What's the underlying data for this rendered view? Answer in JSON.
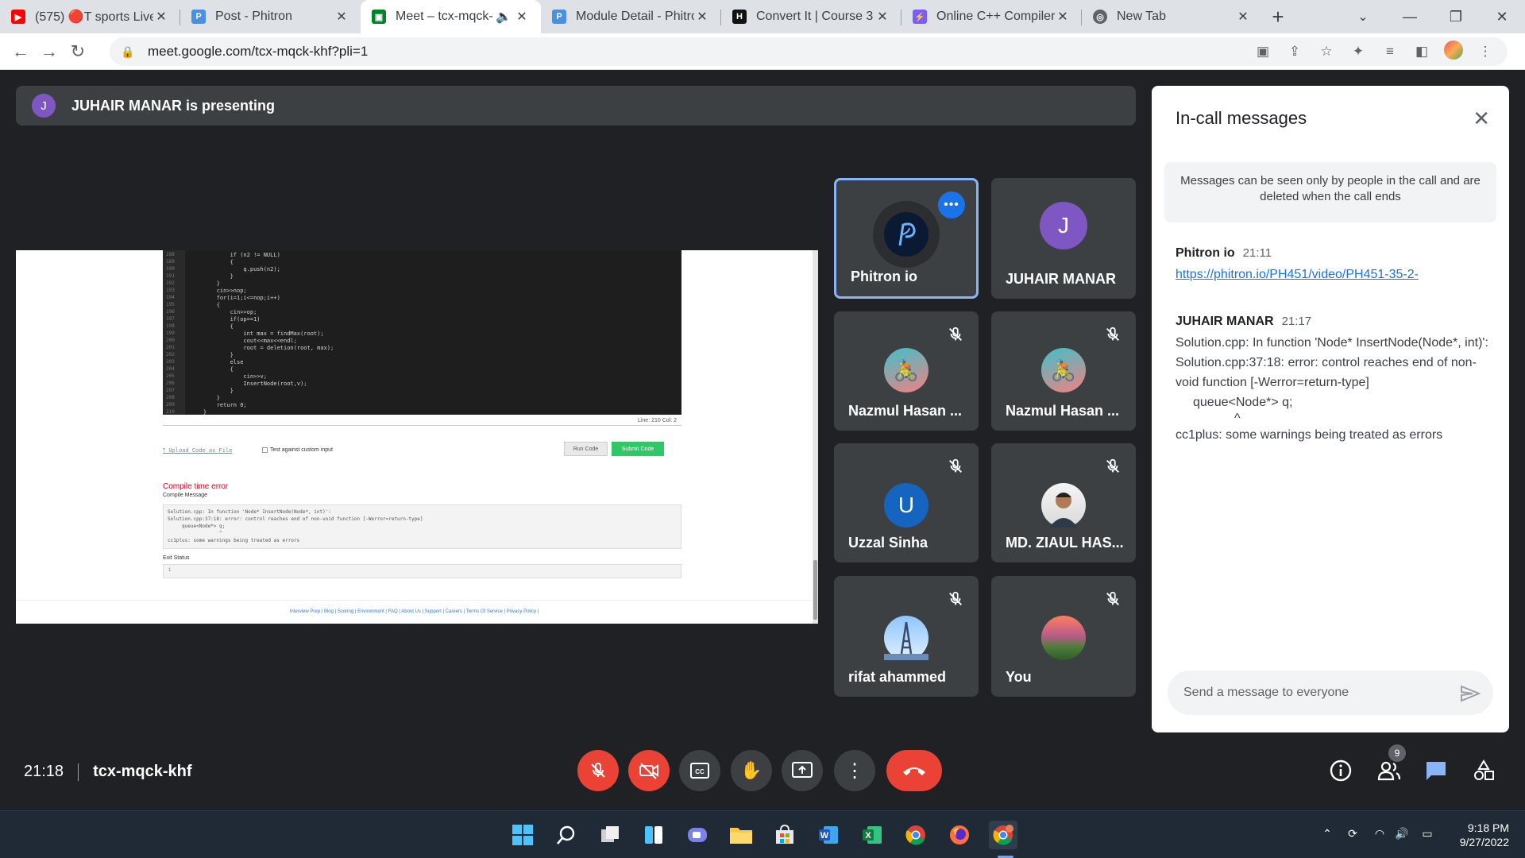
{
  "browser": {
    "tabs": [
      {
        "title": "(575) 🔴T sports Live",
        "favicon_color": "#ff0000",
        "favicon_glyph": "▶"
      },
      {
        "title": "Post - Phitron",
        "favicon_color": "#4a90e2",
        "favicon_glyph": "P"
      },
      {
        "title": "Meet – tcx-mqck-",
        "favicon_color": "#00832d",
        "favicon_glyph": "▣",
        "audio_icon": "speaker-icon"
      },
      {
        "title": "Module Detail - Phitron",
        "favicon_color": "#4a90e2",
        "favicon_glyph": "P"
      },
      {
        "title": "Convert It | Course 3 |",
        "favicon_color": "#111111",
        "favicon_glyph": "H"
      },
      {
        "title": "Online C++ Compiler",
        "favicon_color": "#7b5cff",
        "favicon_glyph": "⚡"
      },
      {
        "title": "New Tab",
        "favicon_color": "#5f6368",
        "favicon_glyph": "◎"
      }
    ],
    "new_tab_label": "+",
    "url": "meet.google.com/tcx-mqck-khf?pli=1"
  },
  "meet": {
    "presenting_banner": "JUHAIR MANAR is presenting",
    "presenter_initial": "J",
    "shared_screen": {
      "code_lines": [
        {
          "n": "188",
          "t": "            if (n2 != NULL)"
        },
        {
          "n": "189",
          "t": "            {"
        },
        {
          "n": "190",
          "t": "                q.push(n2);"
        },
        {
          "n": "191",
          "t": "            }"
        },
        {
          "n": "192",
          "t": "        }"
        },
        {
          "n": "193",
          "t": "        cin>>nop;"
        },
        {
          "n": "194",
          "t": "        for(i=1;i<=nop;i++)"
        },
        {
          "n": "195",
          "t": "        {"
        },
        {
          "n": "196",
          "t": "            cin>>op;"
        },
        {
          "n": "197",
          "t": "            if(op==1)"
        },
        {
          "n": "198",
          "t": "            {"
        },
        {
          "n": "199",
          "t": "                int max = findMax(root);"
        },
        {
          "n": "200",
          "t": "                cout<<max<<endl;"
        },
        {
          "n": "201",
          "t": "                root = deletion(root, max);"
        },
        {
          "n": "202",
          "t": "            }"
        },
        {
          "n": "203",
          "t": "            else"
        },
        {
          "n": "204",
          "t": "            {"
        },
        {
          "n": "205",
          "t": "                cin>>v;"
        },
        {
          "n": "206",
          "t": "                InsertNode(root,v);"
        },
        {
          "n": "207",
          "t": "            }"
        },
        {
          "n": "208",
          "t": "        }"
        },
        {
          "n": "209",
          "t": "        return 0;"
        },
        {
          "n": "210",
          "t": "    }"
        }
      ],
      "line_col": "Line: 210 Col: 2",
      "upload_link": "Upload Code as File",
      "custom_input_label": "Test against custom input",
      "run_code": "Run Code",
      "submit_code": "Submit Code",
      "error_title": "Compile time error",
      "compile_message_label": "Compile Message",
      "compile_message": "Solution.cpp: In function 'Node* InsertNode(Node*, int)':\nSolution.cpp:37:18: error: control reaches end of non-void function [-Werror=return-type]\n     queue<Node*> q;\n                  ^\ncc1plus: some warnings being treated as errors",
      "exit_status_label": "Exit Status",
      "exit_status": "1",
      "footer_links": "Interview Prep | Blog | Scoring | Environment | FAQ | About Us | Support | Careers | Terms Of Service | Privacy Policy |"
    },
    "participants": [
      {
        "name": "Phitron io",
        "avatar": "phitron-logo",
        "selected": true
      },
      {
        "name": "JUHAIR MANAR",
        "initial": "J",
        "avatar_color": "#7e57c2"
      },
      {
        "name": "Nazmul Hasan ...",
        "avatar": "cyclist-photo",
        "muted": true
      },
      {
        "name": "Nazmul Hasan ...",
        "avatar": "cyclist-photo",
        "muted": true
      },
      {
        "name": "Uzzal Sinha",
        "initial": "U",
        "avatar_color": "#1565c0",
        "muted": true
      },
      {
        "name": "MD. ZIAUL HAS...",
        "avatar": "person-photo",
        "muted": true
      },
      {
        "name": "rifat ahammed",
        "avatar": "eiffel-photo",
        "muted": true
      },
      {
        "name": "You",
        "avatar": "landscape-photo",
        "muted": true
      }
    ],
    "messages_panel": {
      "title": "In-call messages",
      "note": "Messages can be seen only by people in the call and are deleted when the call ends",
      "messages": [
        {
          "sender": "Phitron io",
          "time": "21:11",
          "link": "https://phitron.io/PH451/video/PH451-35-2-"
        },
        {
          "sender": "JUHAIR MANAR",
          "time": "21:17",
          "lines": [
            "Solution.cpp: In function 'Node* InsertNode(Node*, int)':",
            "Solution.cpp:37:18: error: control reaches end of non-void function [-Werror=return-type]",
            "queue<Node*> q;",
            "^",
            "cc1plus: some warnings being treated as errors"
          ]
        }
      ],
      "input_placeholder": "Send a message to everyone"
    },
    "bottom_bar": {
      "time": "21:18",
      "meeting_code": "tcx-mqck-khf",
      "people_count": "9"
    }
  },
  "taskbar": {
    "time": "9:18 PM",
    "date": "9/27/2022"
  },
  "colors": {
    "meet_bg": "#202124",
    "tile_bg": "#3c4043",
    "accent_blue": "#1a73e8",
    "hangup_red": "#ea4335",
    "submit_green": "#2ec866"
  }
}
